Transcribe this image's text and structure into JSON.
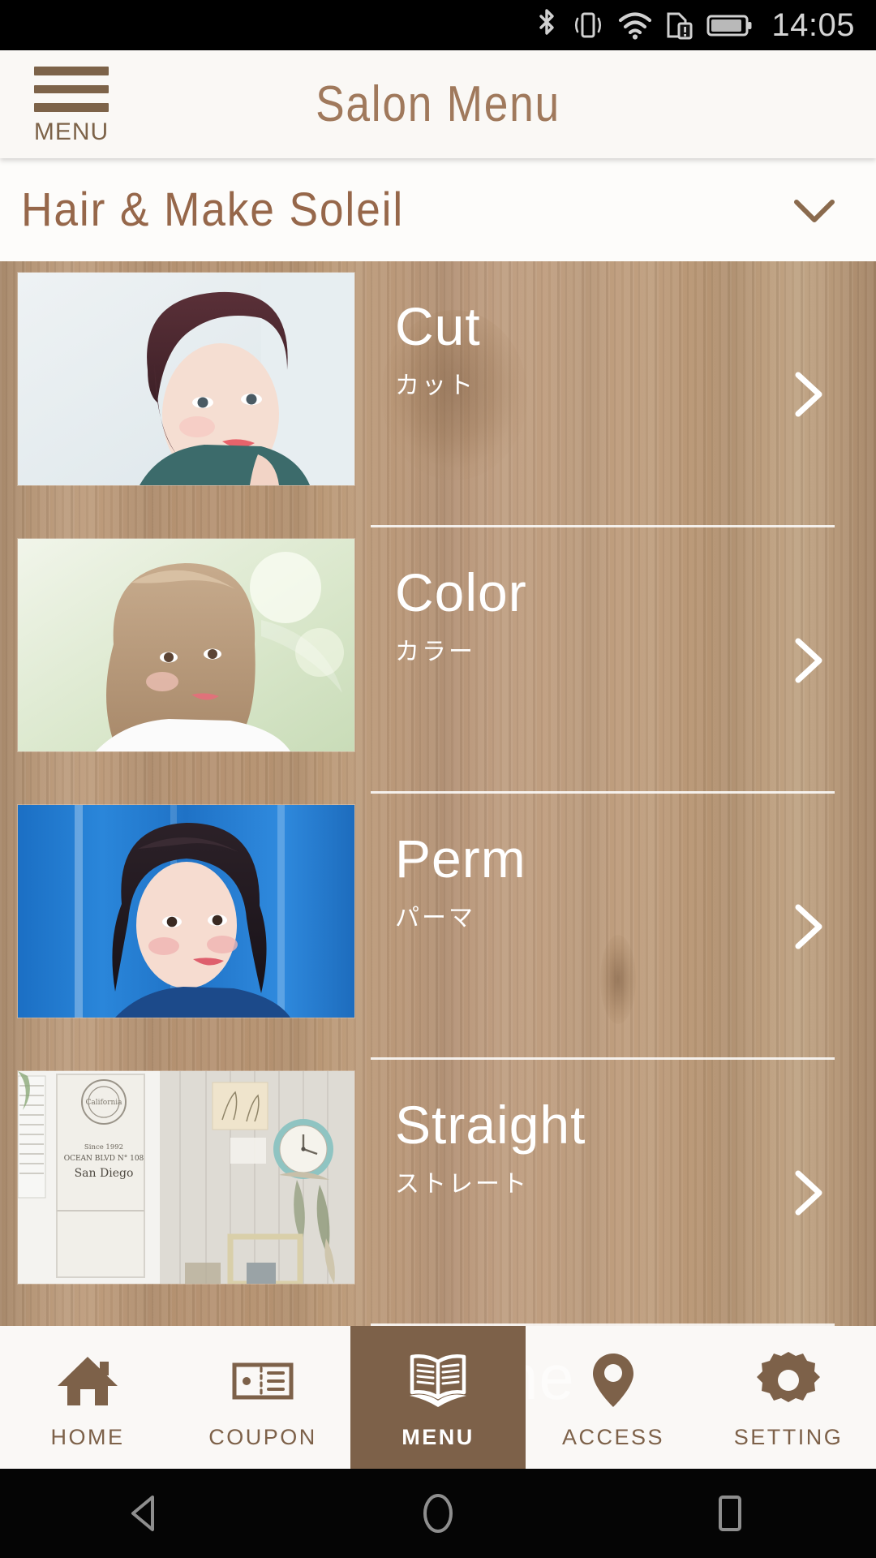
{
  "status_bar": {
    "time": "14:05",
    "icons": [
      "bluetooth-icon",
      "vibrate-icon",
      "wifi-icon",
      "sim-alert-icon",
      "battery-icon"
    ]
  },
  "header": {
    "title": "Salon Menu",
    "menu_button_label": "MENU",
    "accent_color": "#7d6349",
    "title_color": "#a0795c",
    "background": "#faf8f5"
  },
  "salon_bar": {
    "name": "Hair & Make Soleil",
    "expand_icon": "chevron-down-icon",
    "color": "#96674a"
  },
  "menu_list": {
    "background": "wood-texture",
    "items": [
      {
        "title": "Cut",
        "subtitle": "カット",
        "arrow": "chevron-right-icon",
        "thumbnail": "short-dark-hair-portrait"
      },
      {
        "title": "Color",
        "subtitle": "カラー",
        "arrow": "chevron-right-icon",
        "thumbnail": "light-brown-bob-portrait"
      },
      {
        "title": "Perm",
        "subtitle": "パーマ",
        "arrow": "chevron-right-icon",
        "thumbnail": "wavy-hair-blue-wall-portrait"
      },
      {
        "title": "Straight",
        "subtitle": "ストレート",
        "arrow": "chevron-right-icon",
        "thumbnail": "salon-interior-clock-frames"
      }
    ]
  },
  "tab_bar": {
    "active_index": 2,
    "active_background": "#7d6149",
    "inactive_background": "#faf8f6",
    "watermark_text": "ne",
    "tabs": [
      {
        "label": "HOME",
        "icon": "home-icon"
      },
      {
        "label": "COUPON",
        "icon": "coupon-icon"
      },
      {
        "label": "MENU",
        "icon": "book-icon"
      },
      {
        "label": "ACCESS",
        "icon": "map-pin-icon"
      },
      {
        "label": "SETTING",
        "icon": "gear-icon"
      }
    ]
  },
  "android_nav": {
    "buttons": [
      "back-icon",
      "home-circle-icon",
      "recents-icon"
    ]
  }
}
